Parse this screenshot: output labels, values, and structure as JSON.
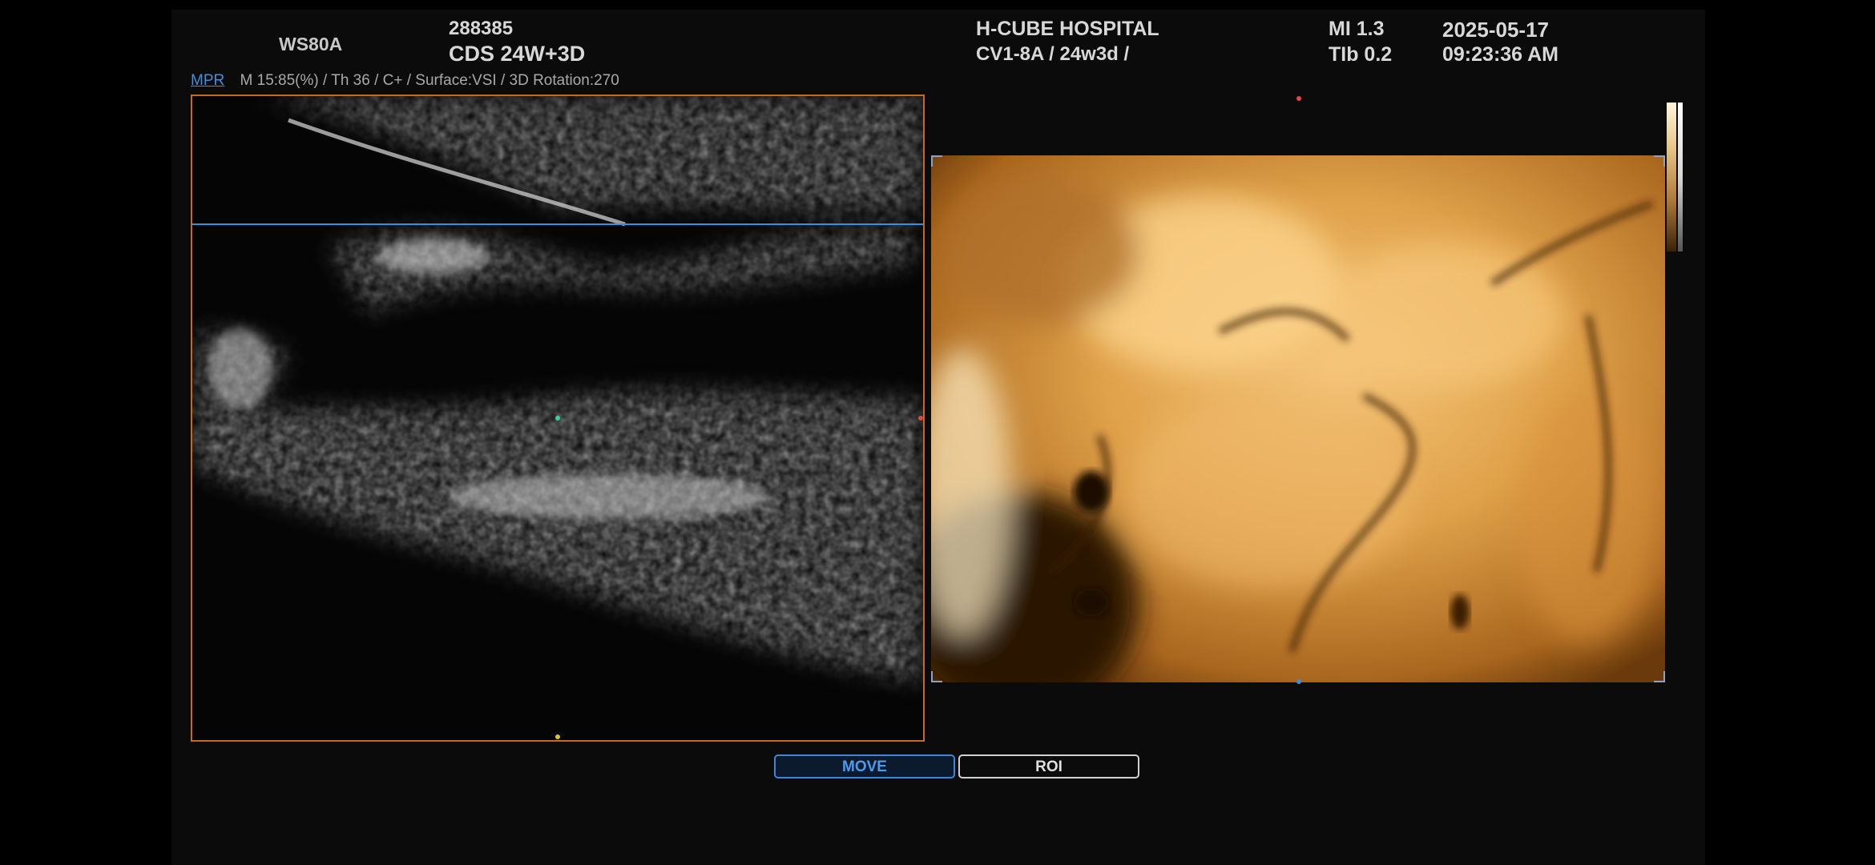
{
  "header": {
    "model": "WS80A",
    "patient_id": "288385",
    "exam": "CDS 24W+3D",
    "hospital": "H-CUBE HOSPITAL",
    "probe": "CV1-8A / 24w3d /",
    "mi": "MI  1.3",
    "tib": "TIb 0.2",
    "date": "2025-05-17",
    "time": "09:23:36 AM"
  },
  "info_line": {
    "mpr_tab": "MPR",
    "params": "M 15:85(%) / Th 36 / C+ / Surface:VSI / 3D Rotation:270"
  },
  "buttons": {
    "move": "MOVE",
    "roi": "ROI"
  },
  "colors": {
    "mpr_border": "#c86a1a",
    "move_accent": "#3d86d8",
    "render_tone": "#e0a24a"
  }
}
